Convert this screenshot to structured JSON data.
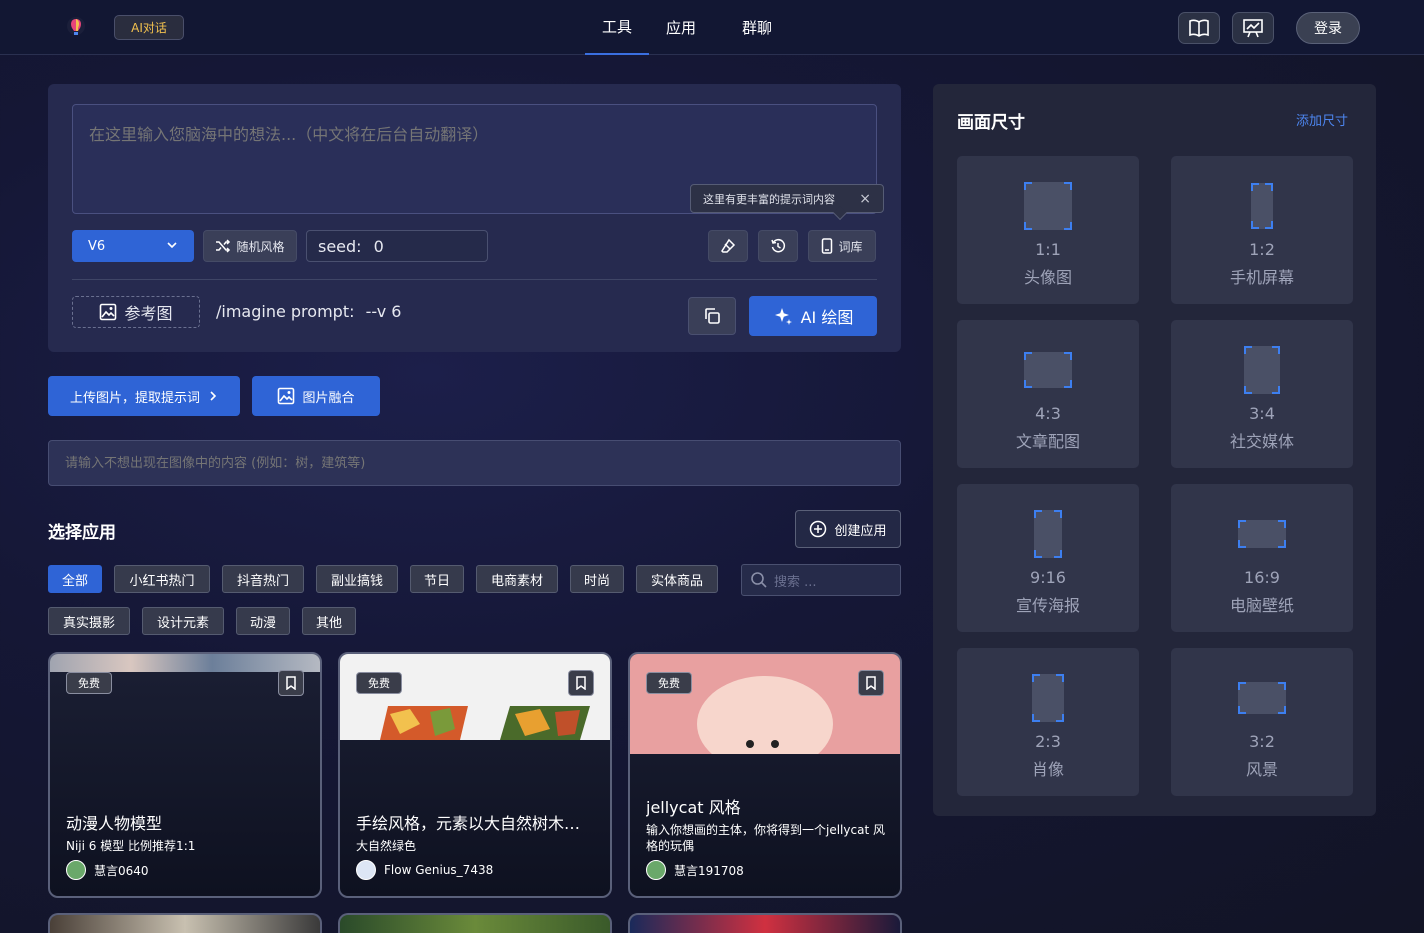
{
  "header": {
    "ai_chat_badge": "AI对话",
    "nav": [
      {
        "label": "工具",
        "active": true
      },
      {
        "label": "应用",
        "active": false
      },
      {
        "label": "群聊",
        "active": false
      }
    ],
    "login_label": "登录"
  },
  "prompt": {
    "placeholder": "在这里输入您脑海中的想法...（中文将在后台自动翻译）",
    "tooltip": "这里有更丰富的提示词内容",
    "version": "V6",
    "random_style": "随机风格",
    "seed_label": "seed:",
    "seed_value": "0",
    "lexicon": "词库",
    "reference_image": "参考图",
    "imagine_prefix": "/imagine prompt:",
    "imagine_suffix": "--v 6",
    "draw_button": "AI 绘图"
  },
  "actions": {
    "upload": "上传图片，提取提示词",
    "blend": "图片融合"
  },
  "negative": {
    "placeholder": "请输入不想出现在图像中的内容 (例如：树，建筑等)"
  },
  "apps": {
    "title": "选择应用",
    "create_button": "创建应用",
    "search_placeholder": "搜索 ...",
    "categories": [
      "全部",
      "小红书热门",
      "抖音热门",
      "副业搞钱",
      "节日",
      "电商素材",
      "时尚",
      "实体商品",
      "真实摄影",
      "设计元素",
      "动漫",
      "其他"
    ],
    "cards": [
      {
        "badge": "免费",
        "title": "动漫人物模型",
        "desc": "Niji 6 模型 比例推荐1:1",
        "author": "慧言0640"
      },
      {
        "badge": "免费",
        "title": "手绘风格，元素以大自然树木、花草为主",
        "desc": "大自然绿色",
        "author": "Flow Genius_7438"
      },
      {
        "badge": "免费",
        "title": "jellycat 风格",
        "desc": "输入你想画的主体，你将得到一个jellycat 风格的玩偶",
        "author": "慧言191708"
      }
    ]
  },
  "size_panel": {
    "title": "画面尺寸",
    "add_label": "添加尺寸",
    "sizes": [
      {
        "ratio": "1:1",
        "label": "头像图"
      },
      {
        "ratio": "1:2",
        "label": "手机屏幕"
      },
      {
        "ratio": "4:3",
        "label": "文章配图"
      },
      {
        "ratio": "3:4",
        "label": "社交媒体"
      },
      {
        "ratio": "9:16",
        "label": "宣传海报"
      },
      {
        "ratio": "16:9",
        "label": "电脑壁纸"
      },
      {
        "ratio": "2:3",
        "label": "肖像"
      },
      {
        "ratio": "3:2",
        "label": "风景"
      }
    ]
  },
  "colors": {
    "accent": "#2f64d6",
    "badge_text": "#f2c14e",
    "link": "#4d86f0"
  }
}
